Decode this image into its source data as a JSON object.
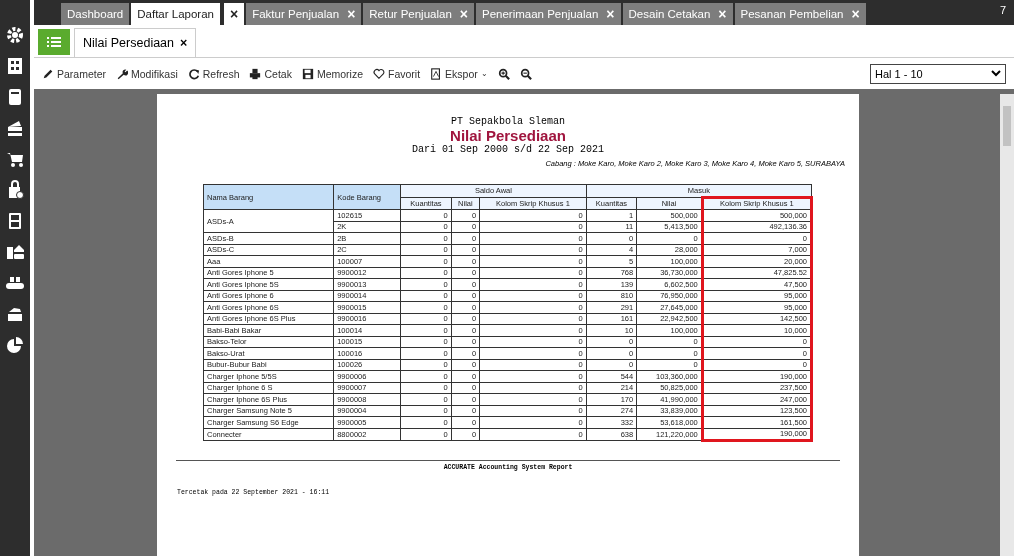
{
  "top_tabs": [
    {
      "label": "Dashboard",
      "selected": false
    },
    {
      "label": "Daftar Laporan",
      "selected": true,
      "close": "×"
    },
    {
      "label": "Faktur Penjualan",
      "selected": false,
      "close": "×"
    },
    {
      "label": "Retur Penjualan",
      "selected": false,
      "close": "×"
    },
    {
      "label": "Penerimaan Penjualan",
      "selected": false,
      "close": "×"
    },
    {
      "label": "Desain Cetakan",
      "selected": false,
      "close": "×"
    },
    {
      "label": "Pesanan Pembelian",
      "selected": false,
      "close": "×"
    }
  ],
  "top_right_badge": "7",
  "sub_tabs": [
    {
      "label": "Nilai Persediaan",
      "selected": true,
      "close": "×"
    }
  ],
  "toolbar": [
    {
      "label": "Parameter"
    },
    {
      "label": "Modifikasi"
    },
    {
      "label": "Refresh"
    },
    {
      "label": "Cetak"
    },
    {
      "label": "Memorize"
    },
    {
      "label": "Favorit"
    },
    {
      "label": "Ekspor",
      "caret": "⌄"
    }
  ],
  "page_select": {
    "value": "Hal 1 - 10"
  },
  "report": {
    "company": "PT Sepakbola Sleman",
    "title": "Nilai Persediaan",
    "period": "Dari 01 Sep 2000 s/d 22 Sep 2021",
    "branch": "Cabang : Moke Karo, Moke Karo 2, Moke Karo 3, Moke Karo 4, Moke Karo 5, SURABAYA",
    "table": {
      "columns": [
        "Nama Barang",
        "Kode Barang"
      ],
      "groups": [
        {
          "label": "Saldo Awal",
          "columns": [
            {
              "label": "Kuantitas",
              "highlighted": false
            },
            {
              "label": "Nilai",
              "highlighted": false
            },
            {
              "label": "Kolom Skrip Khusus 1",
              "highlighted": false
            }
          ]
        },
        {
          "label": "Masuk",
          "columns": [
            {
              "label": "Kuantitas",
              "highlighted": false
            },
            {
              "label": "Nilai",
              "highlighted": false
            },
            {
              "label": "Kolom Skrip Khusus 1",
              "highlighted": true
            }
          ]
        }
      ],
      "rows": [
        {
          "name": "ASDs-A",
          "lines": [
            [
              "102615",
              "0",
              "0",
              "0",
              "1",
              "500,000",
              "500,000"
            ],
            [
              "2K",
              "0",
              "0",
              "0",
              "11",
              "5,413,500",
              "492,136.36"
            ]
          ]
        },
        {
          "name": "ASDs-B",
          "lines": [
            [
              "2B",
              "0",
              "0",
              "0",
              "0",
              "0",
              "0"
            ]
          ]
        },
        {
          "name": "ASDs-C",
          "lines": [
            [
              "2C",
              "0",
              "0",
              "0",
              "4",
              "28,000",
              "7,000"
            ]
          ]
        },
        {
          "name": "Aaa",
          "lines": [
            [
              "100007",
              "0",
              "0",
              "0",
              "5",
              "100,000",
              "20,000"
            ]
          ]
        },
        {
          "name": "Anti Gores Iphone 5",
          "lines": [
            [
              "9900012",
              "0",
              "0",
              "0",
              "768",
              "36,730,000",
              "47,825.52"
            ]
          ]
        },
        {
          "name": "Anti Gores Iphone 5S",
          "lines": [
            [
              "9900013",
              "0",
              "0",
              "0",
              "139",
              "6,602,500",
              "47,500"
            ]
          ]
        },
        {
          "name": "Anti Gores Iphone 6",
          "lines": [
            [
              "9900014",
              "0",
              "0",
              "0",
              "810",
              "76,950,000",
              "95,000"
            ]
          ]
        },
        {
          "name": "Anti Gores Iphone 6S",
          "lines": [
            [
              "9900015",
              "0",
              "0",
              "0",
              "291",
              "27,645,000",
              "95,000"
            ]
          ]
        },
        {
          "name": "Anti Gores Iphone 6S Plus",
          "lines": [
            [
              "9900016",
              "0",
              "0",
              "0",
              "161",
              "22,942,500",
              "142,500"
            ]
          ]
        },
        {
          "name": "Babi-Babi Bakar",
          "lines": [
            [
              "100014",
              "0",
              "0",
              "0",
              "10",
              "100,000",
              "10,000"
            ]
          ]
        },
        {
          "name": "Bakso-Telor",
          "lines": [
            [
              "100015",
              "0",
              "0",
              "0",
              "0",
              "0",
              "0"
            ]
          ]
        },
        {
          "name": "Bakso-Urat",
          "lines": [
            [
              "100016",
              "0",
              "0",
              "0",
              "0",
              "0",
              "0"
            ]
          ]
        },
        {
          "name": "Bubur-Bubur Babi",
          "lines": [
            [
              "100026",
              "0",
              "0",
              "0",
              "0",
              "0",
              "0"
            ]
          ]
        },
        {
          "name": "Charger Iphone 5/5S",
          "lines": [
            [
              "9900006",
              "0",
              "0",
              "0",
              "544",
              "103,360,000",
              "190,000"
            ]
          ]
        },
        {
          "name": "Charger Iphone 6 S",
          "lines": [
            [
              "9900007",
              "0",
              "0",
              "0",
              "214",
              "50,825,000",
              "237,500"
            ]
          ]
        },
        {
          "name": "Charger Iphone 6S Plus",
          "lines": [
            [
              "9900008",
              "0",
              "0",
              "0",
              "170",
              "41,990,000",
              "247,000"
            ]
          ]
        },
        {
          "name": "Charger Samsung Note 5",
          "lines": [
            [
              "9900004",
              "0",
              "0",
              "0",
              "274",
              "33,839,000",
              "123,500"
            ]
          ]
        },
        {
          "name": "Charger Samsung S6 Edge",
          "lines": [
            [
              "9900005",
              "0",
              "0",
              "0",
              "332",
              "53,618,000",
              "161,500"
            ]
          ]
        },
        {
          "name": "Connecter",
          "lines": [
            [
              "8800002",
              "0",
              "0",
              "0",
              "638",
              "121,220,000",
              "190,000"
            ]
          ]
        }
      ]
    },
    "footer_title": "ACCURATE Accounting System Report",
    "printed_at": "Tercetak pada 22 September 2021 - 16:11"
  }
}
